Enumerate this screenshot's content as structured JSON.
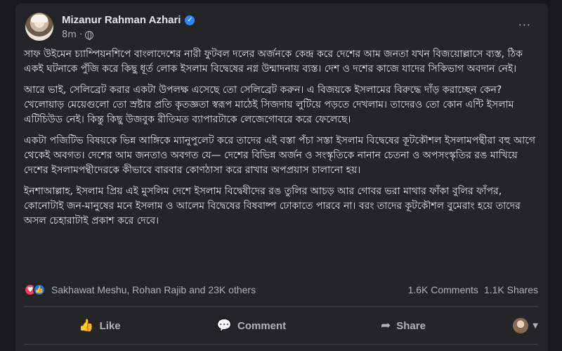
{
  "post": {
    "author": "Mizanur Rahman Azhari",
    "time": "8m ·",
    "more_icon": "···",
    "paragraphs": [
      "সাফ উইমেন চ্যাম্পিয়নশিপে বাংলাদেশের নারী ফুটবল দলের অর্জনকে কেন্দ্র করে দেশের আম জনতা যখন বিজয়োল্লাসে ব্যস্ত, ঠিক একই ঘটনাকে পুঁজি করে কিছু ধূর্ত লোক ইসলাম বিদ্বেষের নগ্ন উন্মাদনায় ব্যস্ত। দেশ ও দশের কাজে যাদের সিকিভাগ অবদান নেই।",
      "আরে ভাই, সেলিব্রেট করার একটা উপলক্ষ এসেছে তো সেলিব্রেট করুন। এ বিজয়কে ইসলামের বিরুদ্ধে দাঁড় করাচ্ছেন কেন? খেলোয়াড় মেয়েগুলো তো স্রষ্টার প্রতি কৃতজ্ঞতা স্বরূপ মাঠেই সিজদায় লুটিয়ে পড়তে দেখলাম। তাদেরও তো কোন এন্টি ইসলাম এটিচিউড নেই। কিন্তু কিছু উজবুক রীতিমত ব্যাপারটাকে লেজেগোবরে করে ফেলেছে।",
      "একটা পজিটিভ বিষয়কে ভিন্ন আঙ্গিকে ম্যানুপুলেট করে তাদের এই বস্তা পঁচা সস্তা ইসলাম বিদ্বেষের কূটকৌশল ইসলামপন্থীরা বহু আগে থেকেই অবগত। দেশের আম জনতাও অবগত যে— দেশের বিভিন্ন অর্জন ও সংস্কৃতিকে নানান চেতনা ও অপসংস্কৃতির রঙ মাখিয়ে দেশের ইসলামপন্থীদেরকে কীভাবে বারবার কোণঠাসা করে রাখার অপপ্রয়াস চালানো হয়।",
      "ইনশাআল্লাহ, ইসলাম প্রিয় এই মুসলিম দেশে ইসলাম বিদ্বেষীদের রঙ তুলির আচড় আর গোবর ভরা মাথার ফাঁকা বুলির ফাঁপর, কোনোটাই জন-মানুষের মনে ইসলাম ও আলেম বিদ্বেষের বিষবাষ্প ঢোকাতে পারবে না। বরং তাদের কূটকৌশল বুমেরাং হয়ে তাদের অসল চেহারাটাই প্রকাশ করে দেবে।"
    ]
  },
  "reactions": {
    "names": "Sakhawat Meshu, Rohan Rajib and 23K others",
    "comments": "1.6K Comments",
    "shares": "1.1K Shares",
    "love_icon": "♥",
    "like_icon": "👍"
  },
  "actions": {
    "like": "Like",
    "comment": "Comment",
    "share": "Share"
  },
  "colors": {
    "background": "#18191a",
    "card": "#242526",
    "text": "#e4e6eb",
    "secondary": "#b0b3b8",
    "accent": "#2d88ff"
  }
}
